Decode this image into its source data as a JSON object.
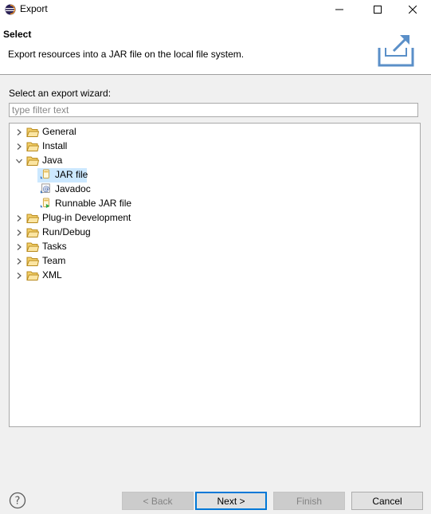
{
  "window": {
    "title": "Export",
    "minimize_icon": "minimize-icon",
    "maximize_icon": "maximize-icon",
    "close_icon": "close-icon"
  },
  "header": {
    "title": "Select",
    "description": "Export resources into a JAR file on the local file system."
  },
  "wizard": {
    "label": "Select an export wizard:",
    "filter_placeholder": "type filter text",
    "filter_value": ""
  },
  "tree": {
    "items": [
      {
        "label": "General",
        "expanded": false,
        "level": 0
      },
      {
        "label": "Install",
        "expanded": false,
        "level": 0
      },
      {
        "label": "Java",
        "expanded": true,
        "level": 0
      },
      {
        "label": "JAR file",
        "level": 1,
        "selected": true,
        "icon": "jar-file-icon"
      },
      {
        "label": "Javadoc",
        "level": 1,
        "icon": "javadoc-icon"
      },
      {
        "label": "Runnable JAR file",
        "level": 1,
        "icon": "runnable-jar-icon"
      },
      {
        "label": "Plug-in Development",
        "expanded": false,
        "level": 0
      },
      {
        "label": "Run/Debug",
        "expanded": false,
        "level": 0
      },
      {
        "label": "Tasks",
        "expanded": false,
        "level": 0
      },
      {
        "label": "Team",
        "expanded": false,
        "level": 0
      },
      {
        "label": "XML",
        "expanded": false,
        "level": 0
      }
    ]
  },
  "buttons": {
    "back": "< Back",
    "next": "Next >",
    "finish": "Finish",
    "cancel": "Cancel"
  },
  "colors": {
    "selection": "#cce8ff",
    "folder": "#e8c35a",
    "accent": "#0078d7"
  }
}
